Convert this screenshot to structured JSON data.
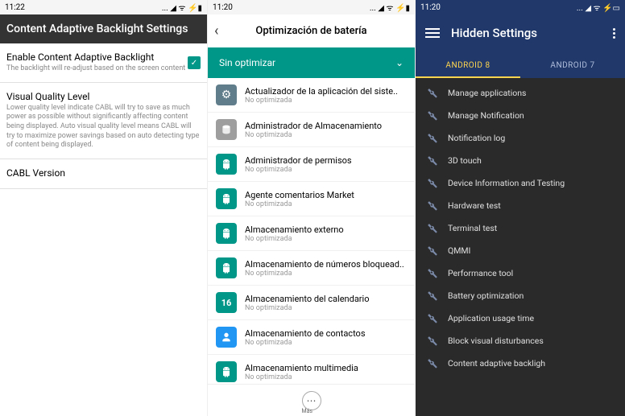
{
  "phone1": {
    "time": "11:22",
    "status_icons": "... ◢ ᯤ ⚡▮",
    "header": "Content Adaptive Backlight Settings",
    "enable_cabl": {
      "title": "Enable Content Adaptive Backlight",
      "sub": "The backlight will re-adjust based on the screen content",
      "checked": true
    },
    "vql": {
      "title": "Visual Quality Level",
      "sub": "Lower quality level indicate CABL will try to save as much power as possible without significantly affecting content being displayed. Auto visual quality level means CABL will try to maximize power savings based on auto detecting type of content being displayed."
    },
    "version": {
      "title": "CABL Version"
    }
  },
  "phone2": {
    "time": "11:20",
    "status_icons": "... ◢ ᯤ ⚡▮",
    "title": "Optimización de batería",
    "dropdown": "Sin optimizar",
    "not_optimized": "No optimizada",
    "more": "Más",
    "apps": [
      {
        "name": "Actualizador de la aplicación del siste..",
        "icon": "gear"
      },
      {
        "name": "Administrador de Almacenamiento",
        "icon": "gray"
      },
      {
        "name": "Administrador de permisos",
        "icon": "teal"
      },
      {
        "name": "Agente comentarios Market",
        "icon": "teal"
      },
      {
        "name": "Almacenamiento externo",
        "icon": "teal"
      },
      {
        "name": "Almacenamiento de números bloquead..",
        "icon": "teal"
      },
      {
        "name": "Almacenamiento del calendario",
        "icon": "cal",
        "badge": "16"
      },
      {
        "name": "Almacenamiento de contactos",
        "icon": "blue"
      },
      {
        "name": "Almacenamiento multimedia",
        "icon": "teal"
      }
    ]
  },
  "phone3": {
    "time": "11:20",
    "status_icons": "... ◢ ᯤ ⚡▭",
    "title": "Hidden Settings",
    "tabs": [
      "ANDROID 8",
      "ANDROID 7"
    ],
    "active_tab": 0,
    "items": [
      "Manage applications",
      "Manage Notification",
      "Notification log",
      "3D touch",
      "Device Information and Testing",
      "Hardware test",
      "Terminal test",
      "QMMI",
      "Performance tool",
      "Battery optimization",
      "Application usage time",
      "Block visual disturbances",
      "Content adaptive backligh"
    ]
  }
}
